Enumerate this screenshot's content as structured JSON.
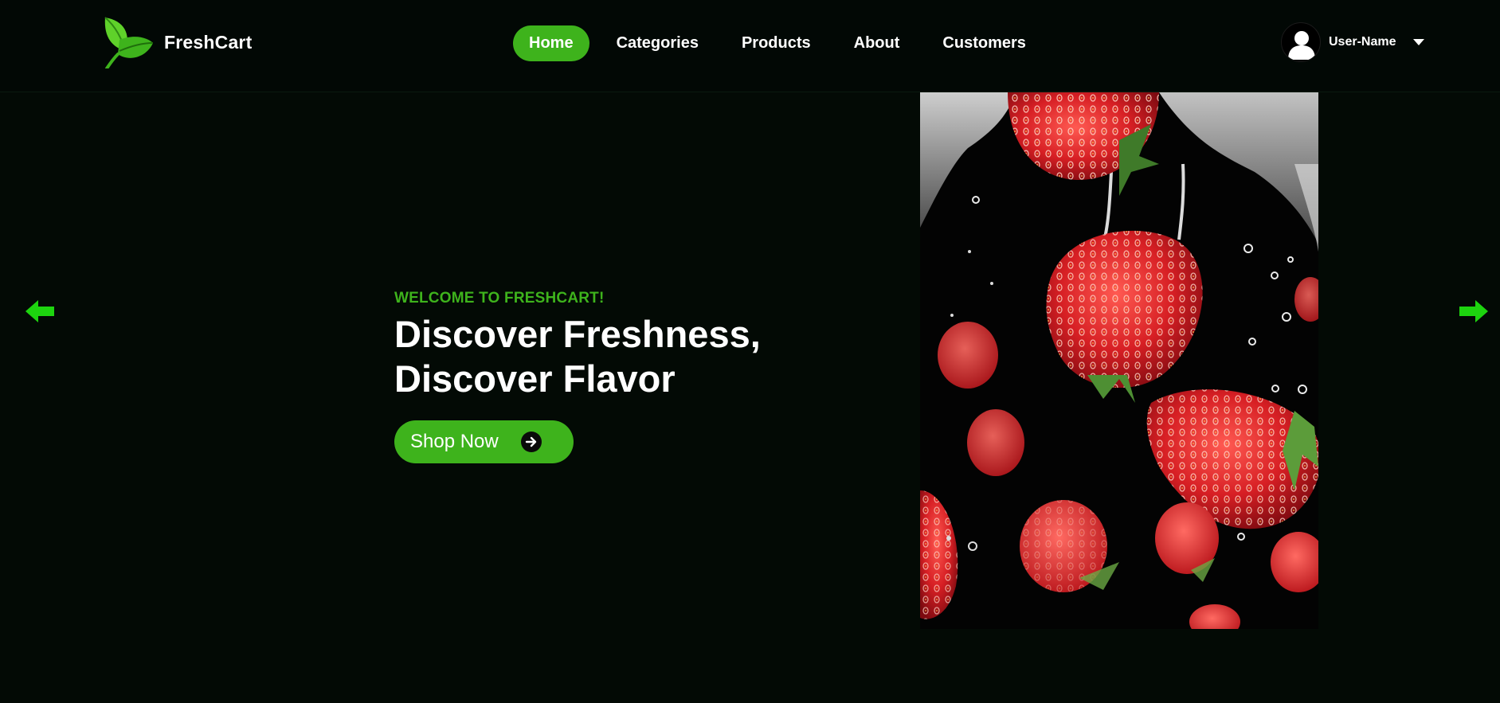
{
  "header": {
    "brand": "FreshCart",
    "nav": [
      {
        "label": "Home",
        "active": true
      },
      {
        "label": "Categories",
        "active": false
      },
      {
        "label": "Products",
        "active": false
      },
      {
        "label": "About",
        "active": false
      },
      {
        "label": "Customers",
        "active": false
      }
    ],
    "user": {
      "name": "User-Name"
    }
  },
  "hero": {
    "eyebrow": "WELCOME TO FRESHCART!",
    "headline_line1": "Discover Freshness,",
    "headline_line2": "Discover Flavor",
    "cta_label": "Shop Now"
  },
  "icons": {
    "logo": "leaf-icon",
    "avatar": "user-avatar-icon",
    "caret": "chevron-down-icon",
    "prev": "arrow-left-icon",
    "next": "arrow-right-icon",
    "cta": "arrow-circle-right-icon"
  },
  "colors": {
    "background": "#030a05",
    "accent": "#3eb31c",
    "arrow": "#1dd40f",
    "text": "#ffffff"
  }
}
